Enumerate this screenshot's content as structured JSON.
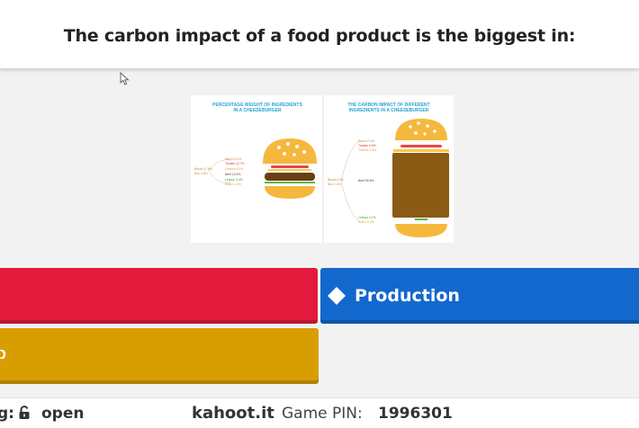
{
  "question": {
    "text": "The carbon impact of a food product is the biggest in:"
  },
  "media": {
    "left_panel": {
      "title_line1": "PERCENTAGE WEIGHT OF INGREDIENTS",
      "title_line2": "IN A CHEESEBURGER",
      "side_label_1": "Bread 47.5%",
      "side_label_2": "Bun 4.8%",
      "labels": [
        "Bacon 3.0%",
        "Tomato 12.7%",
        "Cheese 8.5%",
        "Beef 13.5%",
        "Lettuce 3.4%",
        "Butter 1.6%"
      ]
    },
    "right_panel": {
      "title_line1": "THE CARBON IMPACT OF DIFFERENT",
      "title_line2": "INGREDIENTS IN A CHEESEBURGER",
      "side_label_1": "Bread 6.0%",
      "side_label_2": "Bun 1.4%",
      "labels": [
        "Bacon 0.4%",
        "Tomato 0.8%",
        "Cheese 2.5%",
        "Beef 95.6%",
        "Lettuce 0.1%",
        "Butter 0.4%"
      ]
    }
  },
  "answers": [
    {
      "label": "",
      "color": "#e21b3c"
    },
    {
      "label": "Production",
      "color": "#1368ce",
      "icon": "diamond-icon"
    },
    {
      "label": "",
      "color": "#d89e00"
    }
  ],
  "footer": {
    "access_prefix": "g:",
    "access_status": "open",
    "site": "kahoot.it",
    "pin_label": "Game PIN:",
    "pin_value": "1996301"
  }
}
